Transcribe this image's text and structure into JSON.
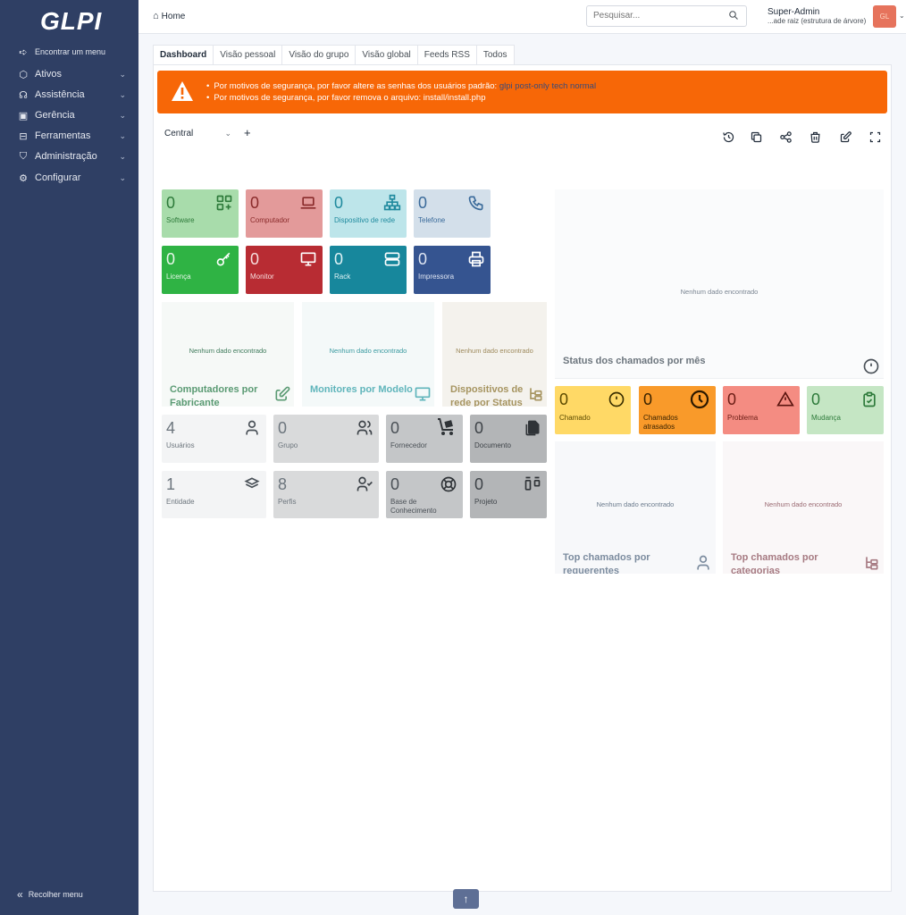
{
  "brand": {
    "logo_text": "GLPI"
  },
  "sidebar": {
    "find_menu": "Encontrar um menu",
    "items": [
      {
        "label": "Ativos"
      },
      {
        "label": "Assistência"
      },
      {
        "label": "Gerência"
      },
      {
        "label": "Ferramentas"
      },
      {
        "label": "Administração"
      },
      {
        "label": "Configurar"
      }
    ],
    "collapse": "Recolher menu"
  },
  "header": {
    "breadcrumb": "Home",
    "search_placeholder": "Pesquisar...",
    "user_name": "Super-Admin",
    "user_entity": "...ade raiz (estrutura de árvore)",
    "avatar_initials": "GL"
  },
  "tabs": [
    "Dashboard",
    "Visão pessoal",
    "Visão do grupo",
    "Visão global",
    "Feeds RSS",
    "Todos"
  ],
  "alert": {
    "line1_prefix": "Por motivos de segurança, por favor altere as senhas dos usuários padrão:",
    "line1_users": "glpi post-only tech normal",
    "line2": "Por motivos de segurança, por favor remova o arquivo: install/install.php"
  },
  "dashboard": {
    "selected": "Central",
    "add": "+"
  },
  "tiles": {
    "software": {
      "value": "0",
      "label": "Software"
    },
    "computador": {
      "value": "0",
      "label": "Computador"
    },
    "dispositivo_rede": {
      "value": "0",
      "label": "Dispositivo de rede"
    },
    "telefone": {
      "value": "0",
      "label": "Telefone"
    },
    "licenca": {
      "value": "0",
      "label": "Licença"
    },
    "monitor": {
      "value": "0",
      "label": "Monitor"
    },
    "rack": {
      "value": "0",
      "label": "Rack"
    },
    "impressora": {
      "value": "0",
      "label": "Impressora"
    },
    "usuarios": {
      "value": "4",
      "label": "Usuários"
    },
    "grupo": {
      "value": "0",
      "label": "Grupo"
    },
    "fornecedor": {
      "value": "0",
      "label": "Fornecedor"
    },
    "documento": {
      "value": "0",
      "label": "Documento"
    },
    "entidade": {
      "value": "1",
      "label": "Entidade"
    },
    "perfis": {
      "value": "8",
      "label": "Perfis"
    },
    "base_conhecimento": {
      "value": "0",
      "label": "Base de Conhecimento"
    },
    "projeto": {
      "value": "0",
      "label": "Projeto"
    },
    "chamado": {
      "value": "0",
      "label": "Chamado"
    },
    "chamados_atrasados": {
      "value": "0",
      "label": "Chamados atrasados"
    },
    "problema": {
      "value": "0",
      "label": "Problema"
    },
    "mudanca": {
      "value": "0",
      "label": "Mudança"
    }
  },
  "panels": {
    "no_data": "Nenhum dado encontrado",
    "computadores_fabricante": "Computadores por Fabricante",
    "monitores_modelo": "Monitores por Modelo",
    "dispositivos_status": "Dispositivos de rede por Status",
    "status_chamados_mes": "Status dos chamados por mês",
    "top_requerentes": "Top chamados por requerentes",
    "top_categorias": "Top chamados por categorias"
  },
  "colors": {
    "sidebar": "#2f3f64",
    "alert": "#f76707",
    "software": "#a8dcab",
    "computador": "#e39a9a",
    "dispositivo_rede": "#bde5ea",
    "telefone": "#d3dfea",
    "licenca": "#2fb344",
    "monitor": "#b82c33",
    "rack": "#17879c",
    "impressora": "#355490"
  },
  "icons": {
    "find_menu": "arrow-right-icon",
    "ativos": "cube-icon",
    "assistencia": "headset-icon",
    "gerencia": "wallet-icon",
    "ferramentas": "briefcase-icon",
    "administracao": "shield-icon",
    "configurar": "gear-icon",
    "collapse": "double-chevron-left-icon",
    "scroll_top": "arrow-up-icon"
  }
}
